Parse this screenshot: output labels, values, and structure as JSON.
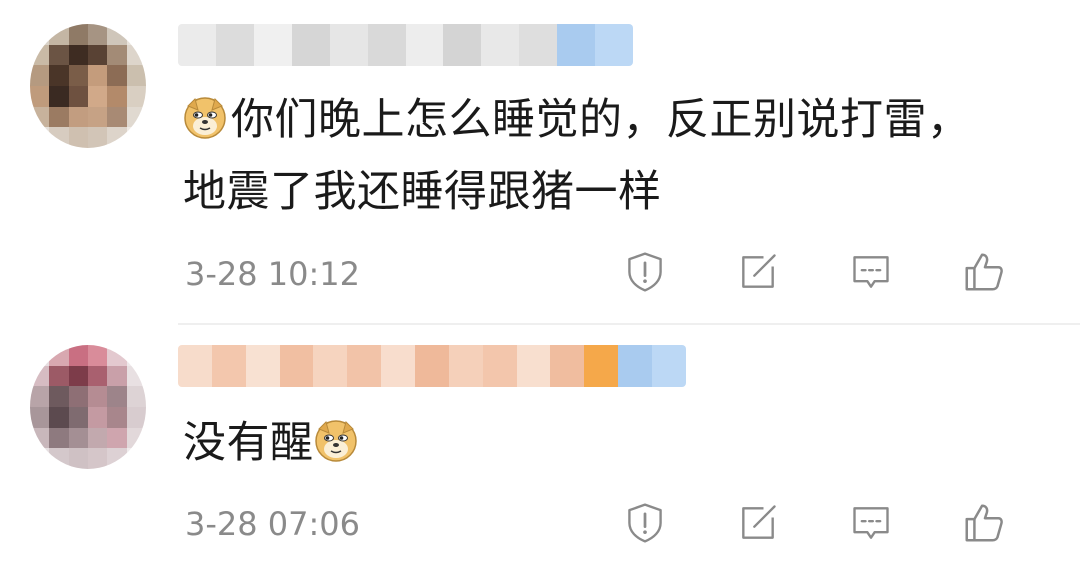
{
  "comments": [
    {
      "text_part1": "你们晚上怎么睡觉的，反正别说打雷，地震了我还睡得跟猪一样",
      "timestamp": "3-28 10:12",
      "emoji": "doge-emoji",
      "emoji_position": "start"
    },
    {
      "text_part1": "没有醒",
      "timestamp": "3-28 07:06",
      "emoji": "doge-emoji",
      "emoji_position": "end"
    }
  ],
  "actions": [
    "report-icon",
    "share-icon",
    "comment-icon",
    "like-icon"
  ],
  "colors": {
    "text": "#1a1a1a",
    "timestamp": "#8a8a8a",
    "icon": "#8a8a8a"
  }
}
